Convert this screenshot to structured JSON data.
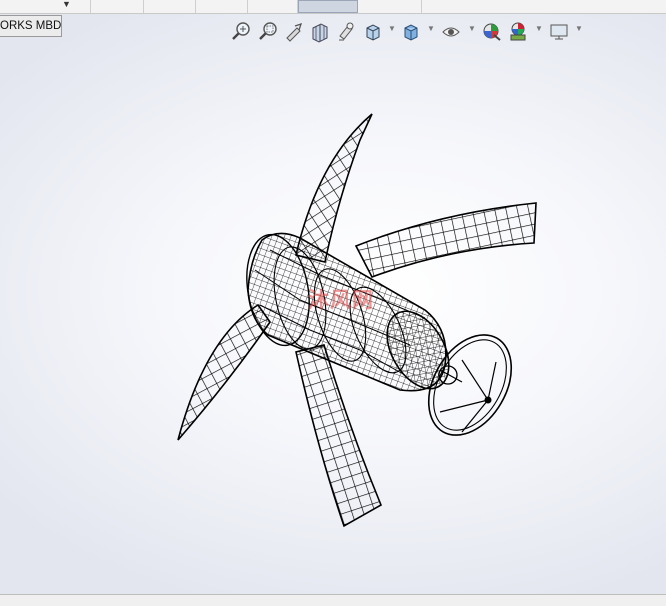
{
  "tab": {
    "label": "ORKS MBD"
  },
  "watermark": {
    "text": "沐风网"
  },
  "toolbar_icons": [
    "zoom-to-fit-icon",
    "zoom-to-area-icon",
    "previous-view-icon",
    "section-view-icon",
    "dynamic-annotation-view-icon",
    "view-orientation-icon",
    "display-style-icon",
    "hide-show-items-icon",
    "edit-appearance-icon",
    "apply-scene-icon",
    "view-settings-icon"
  ],
  "colors": {
    "accent_active_tab": "#cfd6e2",
    "model_lines": "#000000",
    "watermark": "#e14646"
  }
}
